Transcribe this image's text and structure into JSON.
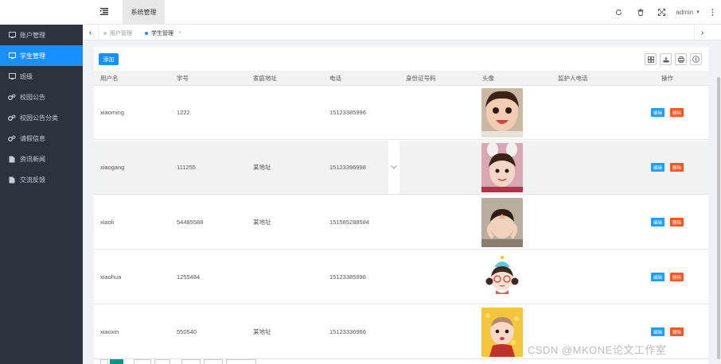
{
  "sidebar": {
    "items": [
      {
        "label": "账户管理",
        "icon": "monitor-icon",
        "active": false
      },
      {
        "label": "学生管理",
        "icon": "monitor-icon",
        "active": true
      },
      {
        "label": "班级",
        "icon": "monitor-icon",
        "active": false
      },
      {
        "label": "校园公告",
        "icon": "gears-icon",
        "active": false
      },
      {
        "label": "校园公告分类",
        "icon": "gears-icon",
        "active": false
      },
      {
        "label": "请假信息",
        "icon": "gears-icon",
        "active": false
      },
      {
        "label": "资讯新闻",
        "icon": "document-icon",
        "active": false
      },
      {
        "label": "交流反馈",
        "icon": "document-icon",
        "active": false
      }
    ]
  },
  "header": {
    "system_tab": "系统管理",
    "user": "admin"
  },
  "tabs": {
    "items": [
      {
        "label": "用户管理",
        "active": false
      },
      {
        "label": "学生管理",
        "active": true,
        "close": "×"
      }
    ]
  },
  "toolbar": {
    "add_label": "添加"
  },
  "table": {
    "headers": {
      "username": "用户名",
      "student_no": "学号",
      "address": "家庭地址",
      "phone": "电话",
      "id_card": "身份证号码",
      "avatar": "头像",
      "guardian_phone": "监护人电话",
      "actions": "操作"
    },
    "rows": [
      {
        "username": "xiaoming",
        "student_no": "1222",
        "address": "",
        "phone": "15123385996",
        "id_card": "",
        "guardian_phone": ""
      },
      {
        "username": "xiaogang",
        "student_no": "111255",
        "address": "某地址",
        "phone": "15123396998",
        "id_card": "",
        "guardian_phone": ""
      },
      {
        "username": "xiaoli",
        "student_no": "54485588",
        "address": "某地址",
        "phone": "151585288584",
        "id_card": "",
        "guardian_phone": ""
      },
      {
        "username": "xiaohua",
        "student_no": "1255484",
        "address": "",
        "phone": "15123385998",
        "id_card": "",
        "guardian_phone": ""
      },
      {
        "username": "xiaoxin",
        "student_no": "550540",
        "address": "某地址",
        "phone": "15123336966",
        "id_card": "",
        "guardian_phone": ""
      }
    ],
    "edit_label": "编辑",
    "delete_label": "删除"
  },
  "watermark": "CSDN @MKONE论文工作室",
  "colors": {
    "sidebar_bg": "#2a333e",
    "accent": "#1890ff",
    "edit": "#1e9fff",
    "delete": "#ff5722",
    "pager": "#009688"
  }
}
